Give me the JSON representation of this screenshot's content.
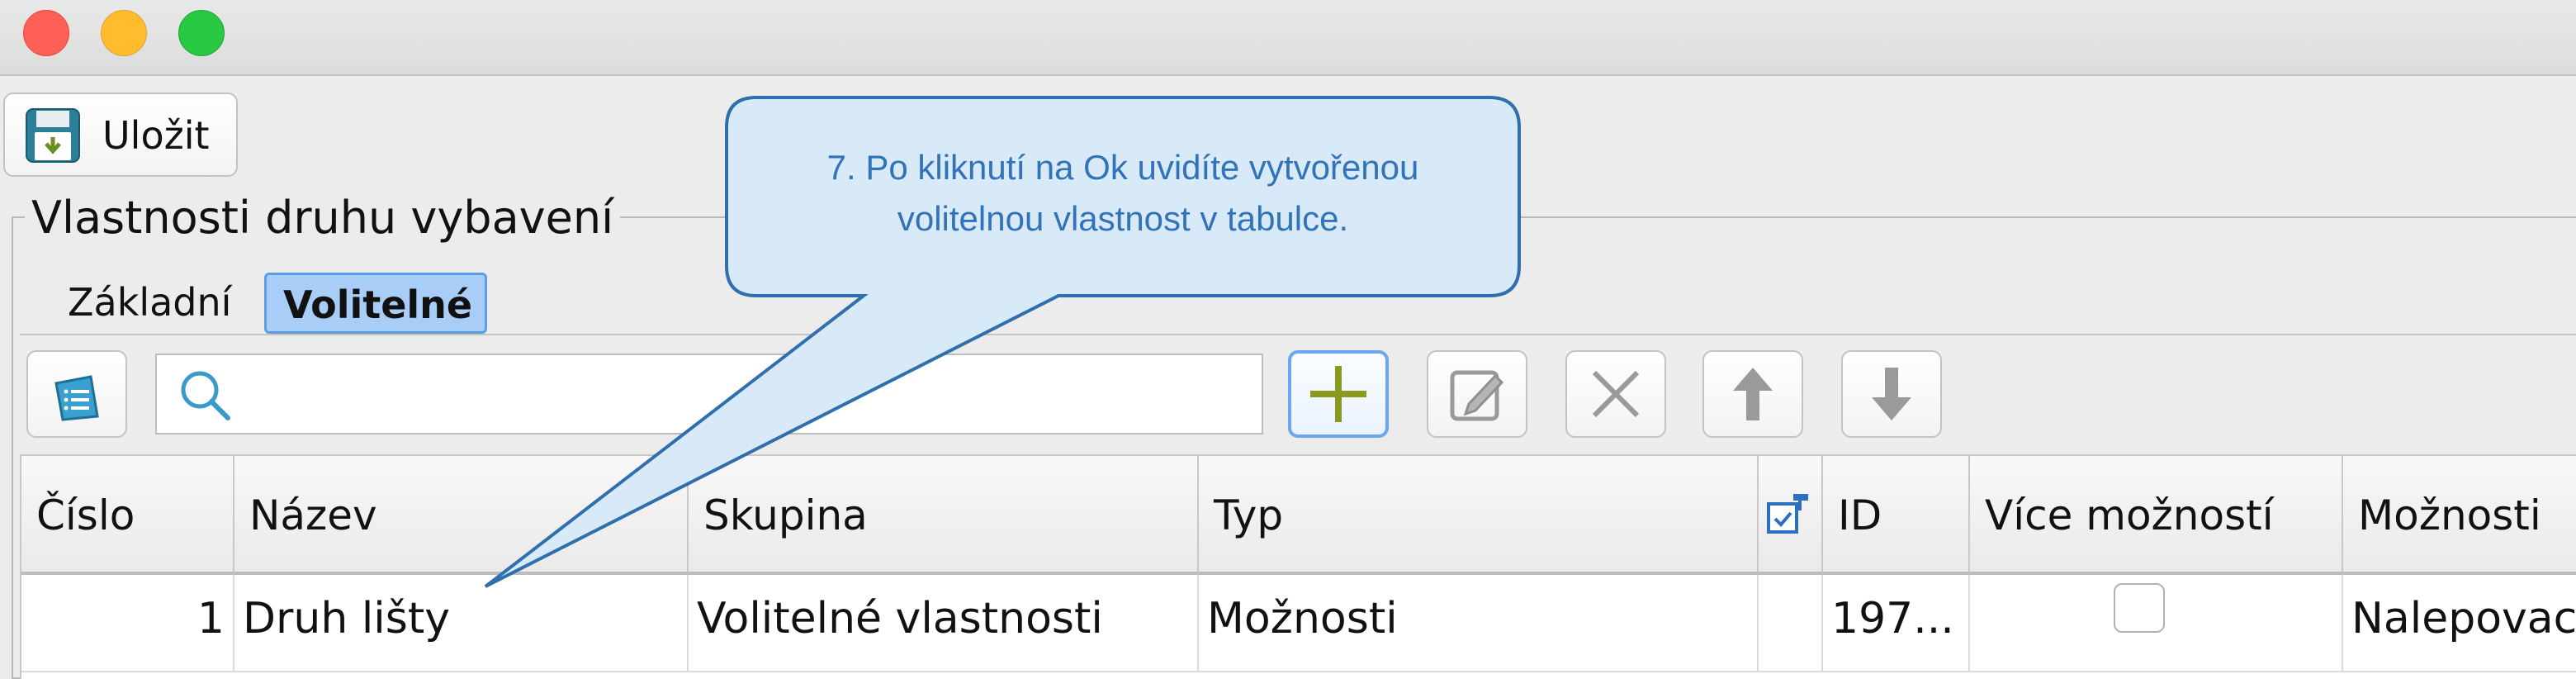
{
  "toolbar": {
    "save_label": "Uložit"
  },
  "panel": {
    "title": "Vlastnosti druhu vybavení",
    "tabs": [
      {
        "label": "Základní",
        "selected": false
      },
      {
        "label": "Volitelné",
        "selected": true
      }
    ]
  },
  "search": {
    "value": "",
    "placeholder": ""
  },
  "table": {
    "columns": [
      "Číslo",
      "Název",
      "Skupina",
      "Typ",
      "",
      "ID",
      "Více možností",
      "Možnosti"
    ],
    "rows": [
      {
        "cislo": "1",
        "nazev": "Druh lišty",
        "skupina": "Volitelné vlastnosti",
        "typ": "Možnosti",
        "id": "197...",
        "vice_moznosti": false,
        "moznosti": "Nalepovac"
      }
    ]
  },
  "callout": {
    "line1": "7. Po kliknutí na Ok uvidíte vytvořenou",
    "line2": "volitelnou vlastnost v tabulce."
  },
  "icons": {
    "save": "floppy-disk-icon",
    "list": "list-icon",
    "search": "magnifier-icon",
    "add": "plus-icon",
    "edit": "edit-icon",
    "delete": "x-icon",
    "up": "arrow-up-icon",
    "down": "arrow-down-icon",
    "column_settings": "column-settings-icon"
  },
  "colors": {
    "accent": "#5b9ee8",
    "callout_text": "#3173b8",
    "callout_border": "#2f6fad"
  }
}
